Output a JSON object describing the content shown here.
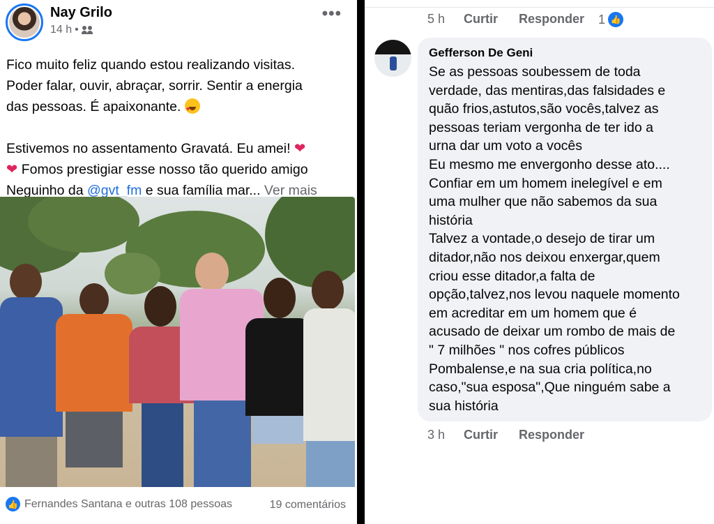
{
  "post": {
    "author": "Nay Grilo",
    "time": "14 h",
    "separator": "•",
    "more": "•••",
    "text_lines": [
      "Fico muito feliz quando estou realizando visitas.",
      "Poder falar, ouvir, abraçar, sorrir. Sentir a energia",
      "das pessoas. É apaixonante."
    ],
    "line4_text": "Estivemos no assentamento Gravatá. Eu amei!",
    "line5_text": "Fomos prestigiar esse nosso tão querido amigo",
    "line6_prefix": "Neguinho da",
    "mention": "@gvt_fm",
    "line6_suffix": "e sua família mar...",
    "see_more": "Ver mais",
    "reactions_text": "Fernandes Santana e outras 108 pessoas",
    "comments_text": "19 comentários"
  },
  "comment_thread": {
    "prev_time": "5 h",
    "like_label": "Curtir",
    "reply_label": "Responder",
    "prev_likes": "1",
    "comment": {
      "author": "Gefferson De Geni",
      "lines": [
        "Se as pessoas soubessem  de toda",
        "verdade, das mentiras,das falsidades  e",
        "quão frios,astutos,são vocês,talvez as",
        "pessoas teriam vergonha de ter ido a",
        "urna dar um voto a vocês",
        "Eu mesmo me envergonho desse ato....",
        "Confiar em um homem inelegível e em",
        "uma mulher que não sabemos da sua",
        "história",
        "Talvez a vontade,o desejo de tirar um",
        "ditador,não  nos deixou enxergar,quem",
        "criou esse ditador,a falta de",
        "opção,talvez,nos levou naquele momento",
        "em acreditar em um homem que é",
        "acusado de deixar um rombo de mais de",
        "\" 7 milhões \" nos cofres públicos",
        "Pombalense,e na sua cria política,no",
        "caso,\"sua esposa\",Que ninguém sabe a",
        "sua história"
      ],
      "time": "3 h"
    }
  },
  "colors": {
    "facebook_blue": "#1877f2",
    "secondary_text": "#65676b",
    "bubble_bg": "#f0f2f5"
  },
  "icons": [
    "friends-icon",
    "more-options-icon",
    "heart-eyes-emoji",
    "red-heart-emoji",
    "like-icon"
  ]
}
